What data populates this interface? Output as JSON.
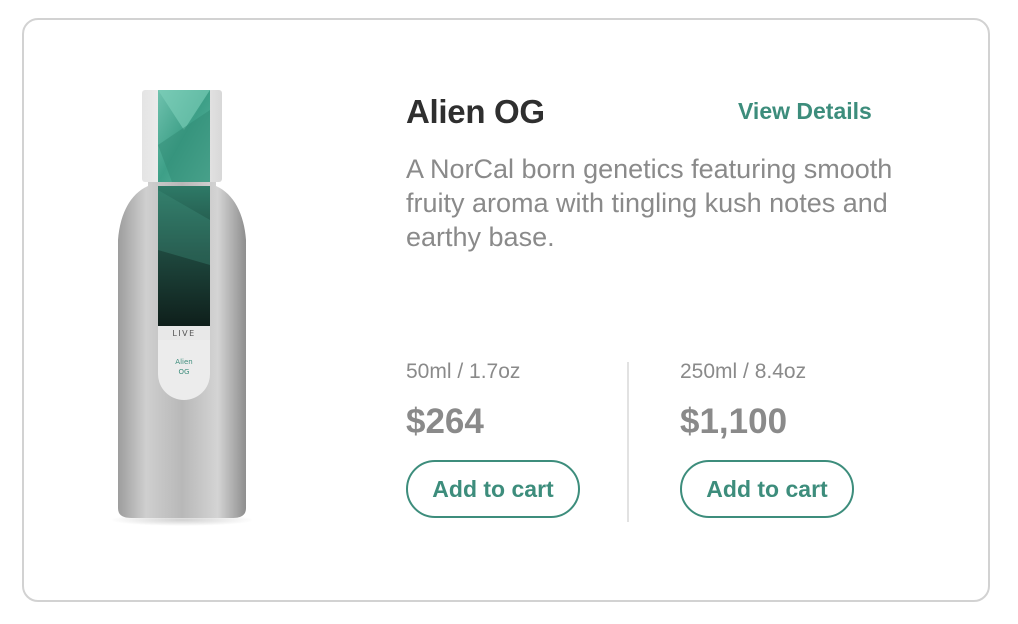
{
  "product": {
    "name": "Alien OG",
    "view_details_label": "View Details",
    "description": "A NorCal born genetics featuring smooth fruity aroma with tingling kush notes and earthy base.",
    "image": {
      "band_text": "LIVE",
      "label_line1": "Alien",
      "label_line2": "OG"
    }
  },
  "options": [
    {
      "size": "50ml / 1.7oz",
      "price": "$264",
      "button_label": "Add to cart"
    },
    {
      "size": "250ml / 8.4oz",
      "price": "$1,100",
      "button_label": "Add to cart"
    }
  ],
  "colors": {
    "accent": "#3d8d7c",
    "title": "#2f2f2f",
    "muted_text": "#8a8a8a",
    "border": "#d2d2d2"
  }
}
